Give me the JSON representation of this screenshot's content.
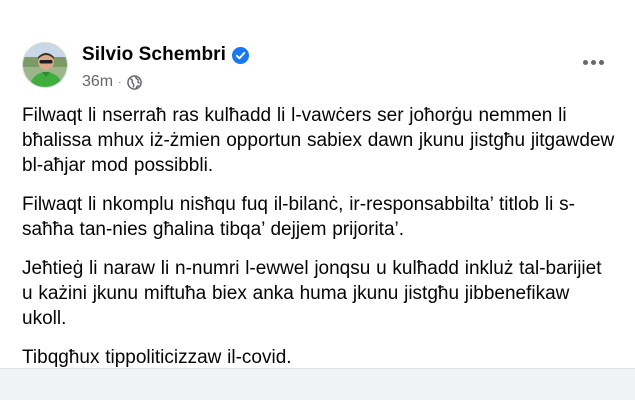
{
  "post": {
    "author": {
      "name": "Silvio Schembri",
      "verified": true,
      "avatar_icon": "profile-photo"
    },
    "meta": {
      "time": "36m",
      "separator": "·",
      "audience_icon": "globe-icon"
    },
    "more_icon": "ellipsis-icon",
    "paragraphs": [
      "Filwaqt li nserraħ ras kulħadd li l-vawċers ser joħorġu nemmen li bħalissa mhux iż-żmien opportun sabiex dawn jkunu jistgħu jitgawdew bl-aħjar mod possibbli.",
      "Filwaqt li nkomplu nisħqu fuq il-bilanċ, ir-responsabbilta’ titlob li s-saħħa tan-nies għalina tibqa’ dejjem prijorita’.",
      "Jeħtieġ li naraw li n-numri l-ewwel jonqsu u kulħadd inkluż tal-barijiet u każini jkunu miftuħa biex anka huma jkunu jistgħu jibbenefikaw ukoll.",
      "Tibqgħux tippoliticizzaw il-covid."
    ]
  },
  "colors": {
    "verified_badge": "#1877f2",
    "secondary_text": "#65676b",
    "primary_text": "#050505",
    "page_background": "#f0f2f5",
    "card_background": "#ffffff"
  }
}
